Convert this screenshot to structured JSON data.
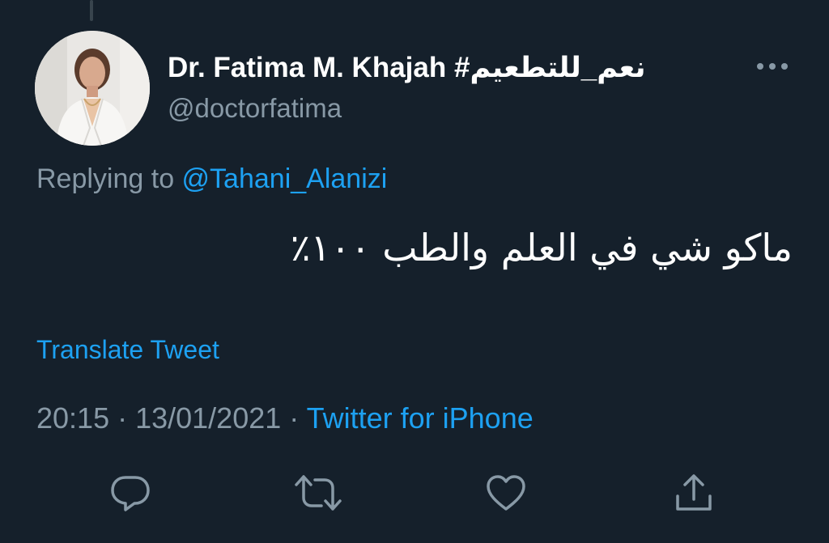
{
  "tweet": {
    "display_name": "Dr. Fatima M. Khajah #نعم_للتطعيم",
    "handle": "@doctorfatima",
    "replying_prefix": "Replying to ",
    "replying_to": "@Tahani_Alanizi",
    "text": "ماكو شي في العلم والطب ١٠٠٪",
    "translate_label": "Translate Tweet",
    "time": "20:15",
    "separator": " · ",
    "date": "13/01/2021",
    "source": "Twitter for iPhone"
  },
  "icons": {
    "more": "more-horizontal-icon",
    "reply": "reply-bubble-icon",
    "retweet": "retweet-icon",
    "like": "heart-icon",
    "share": "share-upload-icon"
  },
  "colors": {
    "background": "#15202b",
    "primary_text": "#ffffff",
    "secondary_text": "#8899a6",
    "link": "#1da1f2"
  }
}
